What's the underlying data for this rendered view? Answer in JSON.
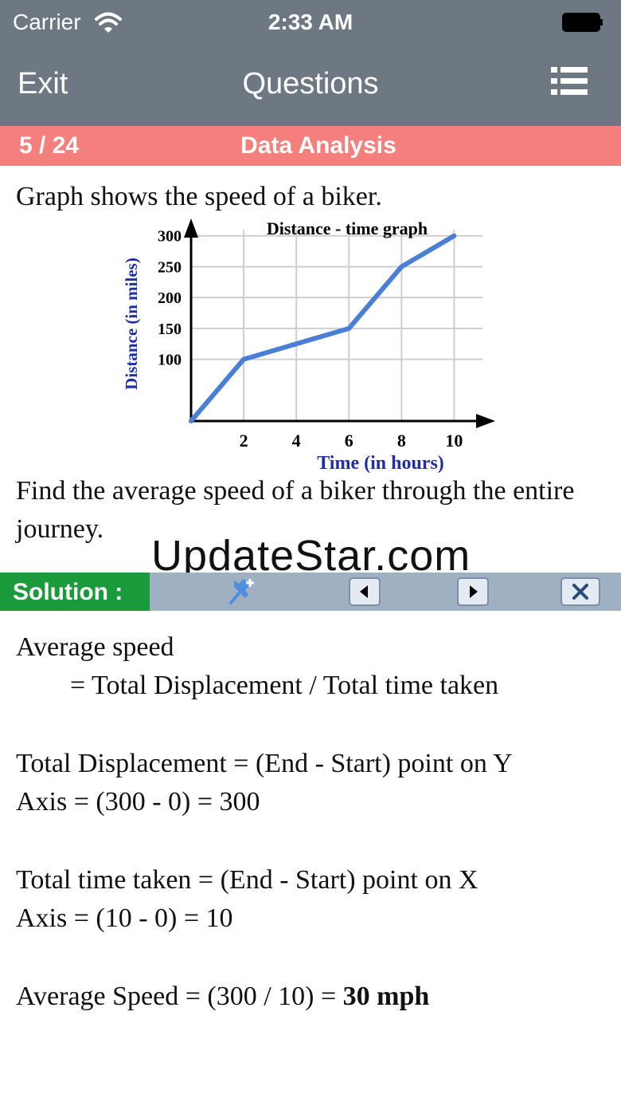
{
  "status": {
    "carrier": "Carrier",
    "time": "2:33 AM"
  },
  "nav": {
    "exit_label": "Exit",
    "title": "Questions"
  },
  "category_bar": {
    "count": "5 / 24",
    "category": "Data Analysis"
  },
  "question": {
    "intro": "Graph shows the speed of a biker.",
    "prompt": "Find the average speed of a biker through the entire journey."
  },
  "watermark": "UpdateStar.com",
  "solution_bar": {
    "label": "Solution :"
  },
  "solution": {
    "line1": "Average speed",
    "line2": "= Total Displacement / Total time taken",
    "line3": "Total Displacement = (End - Start) point on Y",
    "line4": "Axis = (300 - 0) = 300",
    "line5": "Total time taken = (End - Start) point on X",
    "line6": "Axis = (10 - 0) = 10",
    "line7": "Average Speed = (300 / 10) = ",
    "line7_bold": "30 mph"
  },
  "chart_data": {
    "type": "line",
    "title": "Distance - time graph",
    "xlabel": "Time (in hours)",
    "ylabel": "Distance (in miles)",
    "x_ticks": [
      "2",
      "4",
      "6",
      "8",
      "10"
    ],
    "y_ticks": [
      "100",
      "150",
      "200",
      "250",
      "300"
    ],
    "xlim": [
      0,
      11.5
    ],
    "ylim": [
      0,
      310
    ],
    "grid": true,
    "points": [
      [
        0,
        0
      ],
      [
        2,
        100
      ],
      [
        4,
        125
      ],
      [
        6,
        150
      ],
      [
        8,
        250
      ],
      [
        10,
        300
      ]
    ],
    "line_color": "#4a7fd8",
    "label_color": "#1f2ea6"
  }
}
